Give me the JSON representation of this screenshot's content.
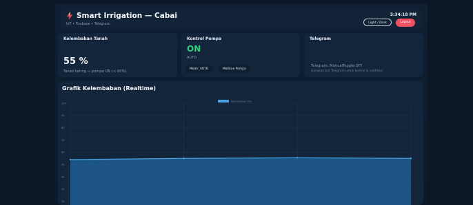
{
  "header": {
    "title": "Smart Irrigation — Cabai",
    "subtitle": "IoT • Firebase • Telegram",
    "clock": "5:34:18 PM",
    "theme_button": "Light / Dark",
    "logout_button": "Logout",
    "icon": "bolt-icon"
  },
  "cards": {
    "moisture": {
      "title": "Kelembaban Tanah",
      "value": "55 %",
      "status": "Tanah kering → pompa ON (< 60%)"
    },
    "pump": {
      "title": "Kontrol Pompa",
      "state": "ON",
      "mode": "AUTO",
      "mode_button": "Mode: AUTO",
      "pump_button": "Matikan Pompa"
    },
    "telegram": {
      "title": "Telegram",
      "status": "Telegram: ManualToggle:OFF",
      "hint": "Gunakan bot Telegram untuk kontrol & notifikasi"
    }
  },
  "chart": {
    "title": "Grafik Kelembaban (Realtime)"
  },
  "colors": {
    "background": "#0b1626",
    "card": "#13253b",
    "accent_green": "#31d17a",
    "logout_red": "#ef5160",
    "series_fill": "#1f5e93",
    "series_line": "#4aa3e0"
  },
  "chart_data": {
    "type": "area",
    "title": "Grafik Kelembaban (Realtime)",
    "series": [
      {
        "name": "Kelembaban (%)",
        "values": [
          54,
          55,
          55.5,
          55
        ]
      }
    ],
    "y_ticks": [
      100,
      90,
      80,
      70,
      60,
      50,
      40,
      30,
      20
    ],
    "ylim": [
      17,
      100
    ],
    "grid": true,
    "legend_position": "top-center"
  }
}
